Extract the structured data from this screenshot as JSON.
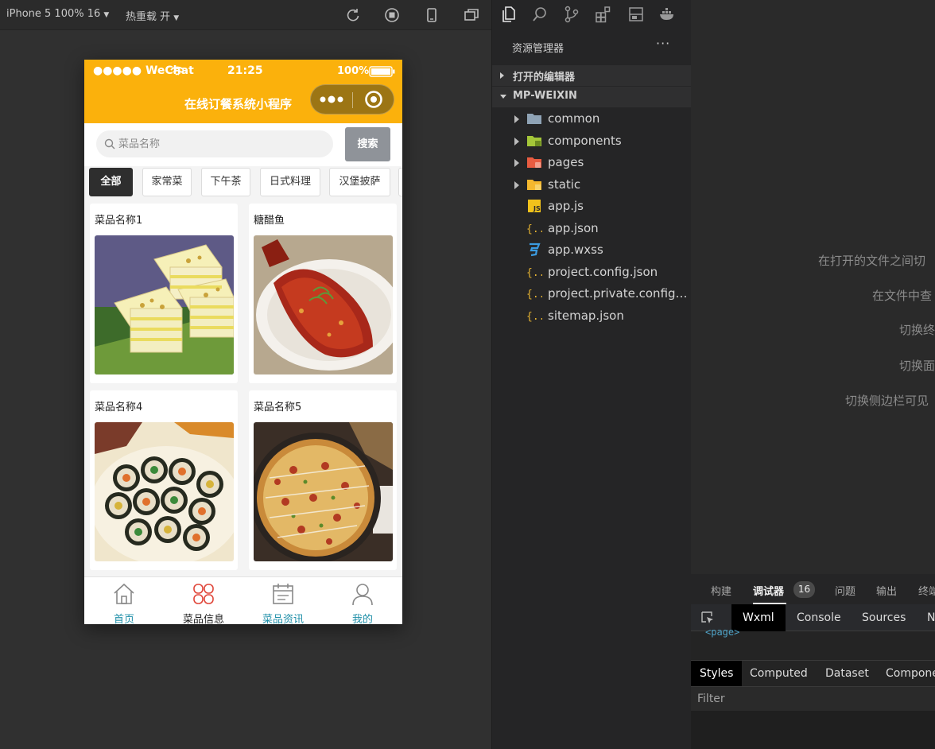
{
  "simulator": {
    "device_label": "iPhone 5 100% 16",
    "hot_reload_label": "热重载 开"
  },
  "phone": {
    "status": {
      "carrier": "●●●●● WeChat",
      "time": "21:25",
      "battery": "100%"
    },
    "nav_title": "在线订餐系统小程序",
    "search": {
      "placeholder": "菜品名称",
      "button_label": "搜索"
    },
    "categories": [
      "全部",
      "家常菜",
      "下午茶",
      "日式料理",
      "汉堡披萨"
    ],
    "active_category": "全部",
    "dishes": [
      {
        "name": "菜品名称1",
        "image_icon": "dessert-cake-photo"
      },
      {
        "name": "糖醋鱼",
        "image_icon": "sweet-sour-fish-photo"
      },
      {
        "name": "菜品名称4",
        "image_icon": "sushi-rolls-photo"
      },
      {
        "name": "菜品名称5",
        "image_icon": "pizza-photo"
      }
    ],
    "tab_bar": [
      {
        "label": "首页",
        "icon": "home-icon"
      },
      {
        "label": "菜品信息",
        "icon": "clover-grid-icon"
      },
      {
        "label": "菜品资讯",
        "icon": "calendar-icon"
      },
      {
        "label": "我的",
        "icon": "user-icon"
      }
    ]
  },
  "explorer": {
    "title": "资源管理器",
    "more": "···",
    "open_editors": "打开的编辑器",
    "project": "MP-WEIXIN",
    "tree": [
      {
        "label": "common",
        "type": "folder",
        "color": "#8fa3b5"
      },
      {
        "label": "components",
        "type": "folder",
        "color": "#a4c639"
      },
      {
        "label": "pages",
        "type": "folder",
        "color": "#e85c41"
      },
      {
        "label": "static",
        "type": "folder",
        "color": "#f5b82e"
      },
      {
        "label": "app.js",
        "type": "js"
      },
      {
        "label": "app.json",
        "type": "json"
      },
      {
        "label": "app.wxss",
        "type": "wxss"
      },
      {
        "label": "project.config.json",
        "type": "json"
      },
      {
        "label": "project.private.config.js...",
        "type": "json"
      },
      {
        "label": "sitemap.json",
        "type": "json"
      }
    ]
  },
  "editor_hints": [
    "在打开的文件之间切",
    "在文件中查",
    "切换终",
    "切换面",
    "切换侧边栏可见"
  ],
  "devtools": {
    "panel_tabs": [
      "构建",
      "调试器",
      "问题",
      "输出",
      "终端"
    ],
    "debugger_badge": "16",
    "tools": [
      "Wxml",
      "Console",
      "Sources",
      "N"
    ],
    "page_tag": "<page>",
    "style_tabs": [
      "Styles",
      "Computed",
      "Dataset",
      "Component"
    ],
    "filter_placeholder": "Filter"
  },
  "colors": {
    "accent_yellow": "#fbb10c",
    "link_teal": "#1f8fa8",
    "ide_bg": "#252526"
  }
}
